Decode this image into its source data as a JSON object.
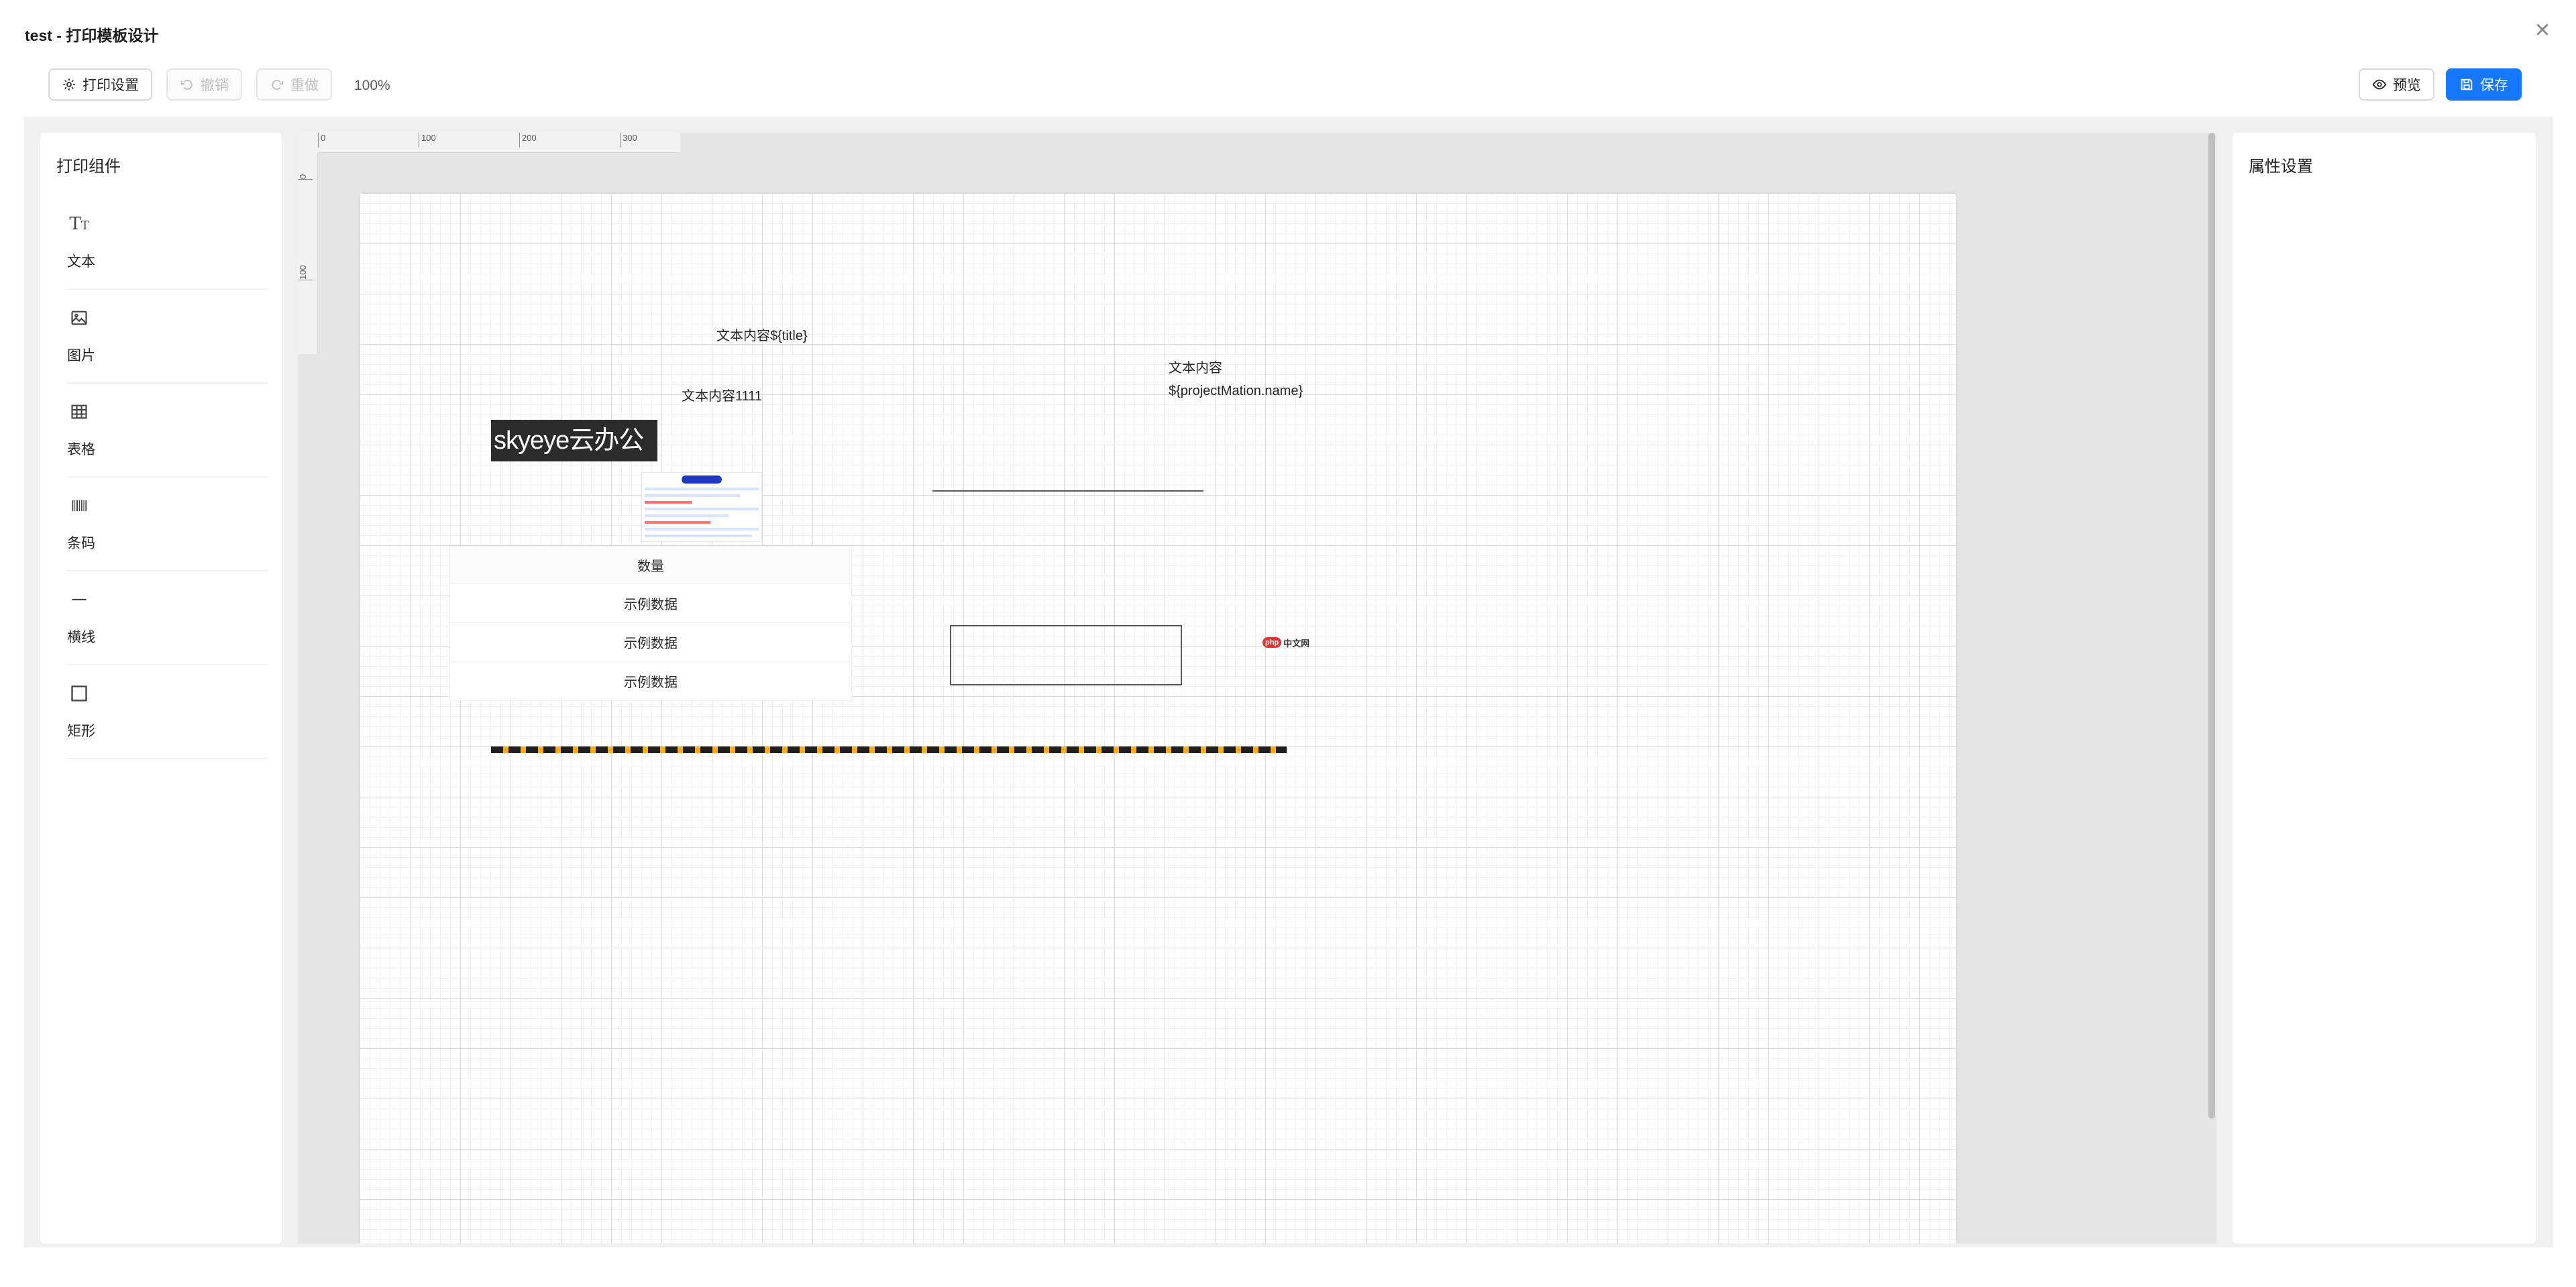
{
  "window": {
    "title": "test - 打印模板设计"
  },
  "toolbar": {
    "print_settings": "打印设置",
    "undo": "撤销",
    "redo": "重做",
    "zoom": "100%",
    "preview": "预览",
    "save": "保存"
  },
  "left_panel": {
    "title": "打印组件",
    "items": [
      {
        "label": "文本",
        "icon": "text-icon"
      },
      {
        "label": "图片",
        "icon": "image-icon"
      },
      {
        "label": "表格",
        "icon": "table-icon"
      },
      {
        "label": "条码",
        "icon": "barcode-icon"
      },
      {
        "label": "横线",
        "icon": "line-icon"
      },
      {
        "label": "矩形",
        "icon": "rectangle-icon"
      }
    ]
  },
  "right_panel": {
    "title": "属性设置"
  },
  "ruler": {
    "h_ticks": [
      "0",
      "100",
      "200",
      "300"
    ],
    "v_ticks": [
      "0",
      "100"
    ]
  },
  "canvas": {
    "text_title": "文本内容${title}",
    "text_1111": "文本内容1111",
    "text_project_line1": "文本内容",
    "text_project_line2": "${projectMation.name}",
    "logo_text": "skyeye云办公",
    "mini_logo_badge": "php",
    "mini_logo_text": "中文网",
    "table": {
      "header": "数量",
      "rows": [
        "示例数据",
        "示例数据",
        "示例数据"
      ]
    }
  },
  "colors": {
    "primary": "#1677ff",
    "canvas_bg": "#e5e5e5",
    "dash_dark": "#1f1f1f",
    "dash_accent": "#faad14"
  }
}
